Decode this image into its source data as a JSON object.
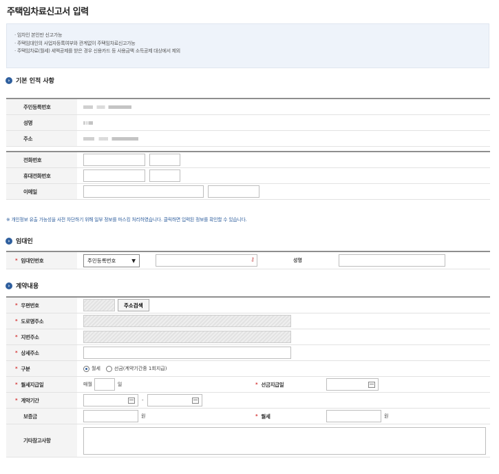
{
  "page": {
    "title": "주택임차료신고서 입력"
  },
  "notice": {
    "items": [
      "· 임차인 본인만 신고가능",
      "· 주택임대인의 사업자등록여부와 관계없이 주택임차료신고가능",
      "· 주택임차료(월세) 세액공제를 받은 경우 신용카드 등 사용금액 소득공제 대상에서 제외"
    ]
  },
  "basic": {
    "section_title": "기본 인적 사항",
    "labels": {
      "rrn": "주민등록번호",
      "name": "성명",
      "address": "주소",
      "phone": "전화번호",
      "mobile": "휴대전화번호",
      "email": "이메일"
    }
  },
  "privacy_note": "※ 개인정보 유출 가능성을 사전 차단하기 위해 일부 정보를 마스킹 처리하였습니다. 클릭하면 입력된 정보를 확인할 수 있습니다.",
  "landlord": {
    "section_title": "임대인",
    "id_label": "임대인번호",
    "id_type": "주민등록번호",
    "name_label": "성명"
  },
  "contract": {
    "section_title": "계약내용",
    "postcode_label": "우편번호",
    "search_button": "주소검색",
    "road_label": "도로명주소",
    "jibun_label": "지번주소",
    "detail_label": "상세주소",
    "type_label": "구분",
    "type_monthly": "월세",
    "type_lump": "선금(계약기간중 1회지급)",
    "pay_day_label": "월세지급일",
    "monthly_prefix": "매월",
    "day_suffix": "일",
    "prepay_label": "선금지급일",
    "period_label": "계약기간",
    "period_sep": "-",
    "deposit_label": "보증금",
    "won": "원",
    "rent_label": "월세",
    "remarks_label": "기타참고사항"
  }
}
